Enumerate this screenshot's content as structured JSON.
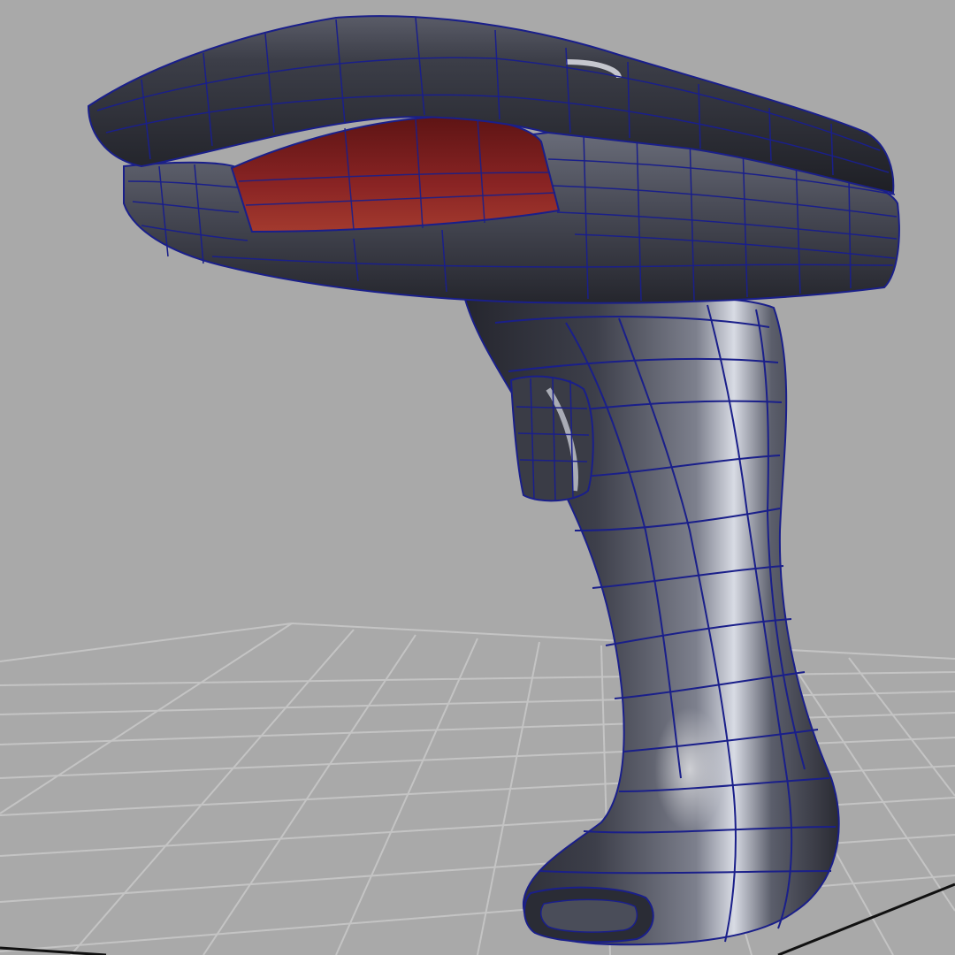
{
  "viewport": {
    "background_color": "#a9a9a9",
    "grid_color": "#c4c4c4",
    "axis_color": "#111111"
  },
  "model": {
    "subject": "barcode-scanner-3d-model",
    "body_color": "#3b3d47",
    "highlight_color": "#d8dbe4",
    "wireframe_color": "#1a1f8a",
    "scan_window_color": "#7a1e1e",
    "display_mode": "smooth-shaded-with-wireframe"
  }
}
